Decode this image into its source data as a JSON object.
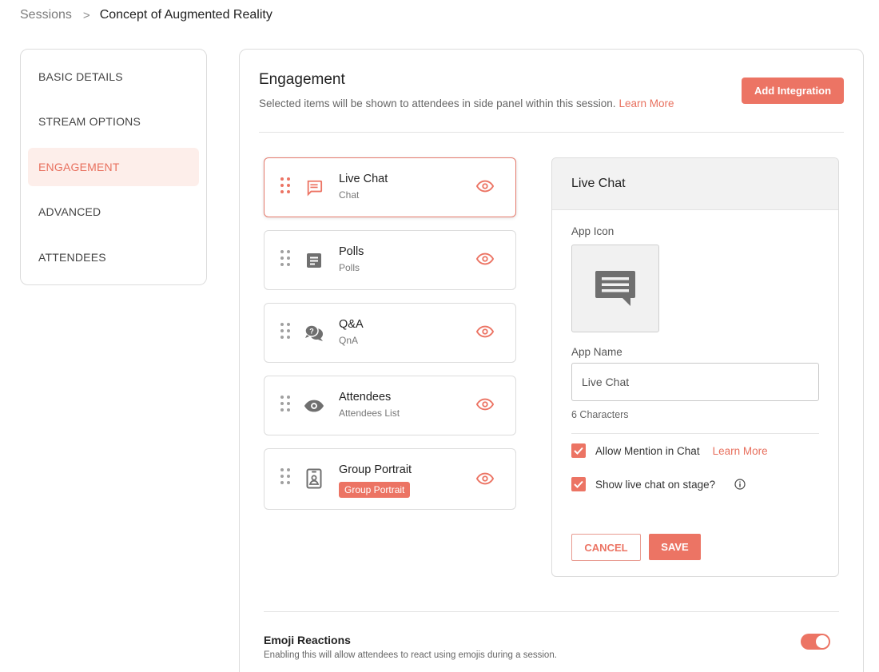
{
  "breadcrumb": {
    "parent": "Sessions",
    "separator": ">",
    "current": "Concept of Augmented Reality"
  },
  "sidebar": {
    "items": [
      {
        "label": "BASIC DETAILS",
        "active": false
      },
      {
        "label": "STREAM OPTIONS",
        "active": false
      },
      {
        "label": "ENGAGEMENT",
        "active": true
      },
      {
        "label": "ADVANCED",
        "active": false
      },
      {
        "label": "ATTENDEES",
        "active": false
      }
    ]
  },
  "main": {
    "title": "Engagement",
    "subtitle": "Selected items will be shown to attendees in side panel within this session.",
    "learn_more": "Learn More",
    "add_integration": "Add Integration"
  },
  "apps": [
    {
      "title": "Live Chat",
      "subtitle": "Chat",
      "icon": "chat-icon",
      "active": true
    },
    {
      "title": "Polls",
      "subtitle": "Polls",
      "icon": "poll-icon",
      "active": false
    },
    {
      "title": "Q&A",
      "subtitle": "QnA",
      "icon": "qna-icon",
      "active": false
    },
    {
      "title": "Attendees",
      "subtitle": "Attendees List",
      "icon": "attendees-eye-icon",
      "active": false
    },
    {
      "title": "Group Portrait",
      "badge": "Group Portrait",
      "icon": "portrait-icon",
      "active": false
    }
  ],
  "detail": {
    "title": "Live Chat",
    "app_icon_label": "App Icon",
    "app_name_label": "App Name",
    "app_name_value": "Live Chat",
    "char_count": "6 Characters",
    "allow_mention_label": "Allow Mention in Chat",
    "allow_mention_checked": true,
    "learn_more": "Learn More",
    "show_stage_label": "Show live chat on stage?",
    "show_stage_checked": true,
    "cancel": "CANCEL",
    "save": "SAVE"
  },
  "emoji": {
    "title": "Emoji Reactions",
    "description": "Enabling this will allow attendees to react using emojis during a session.",
    "enabled": true
  },
  "colors": {
    "accent": "#ec7464",
    "active_nav_bg": "#fdeeea",
    "border": "#dcdcdc",
    "icon_gray": "#6f6f6f"
  }
}
